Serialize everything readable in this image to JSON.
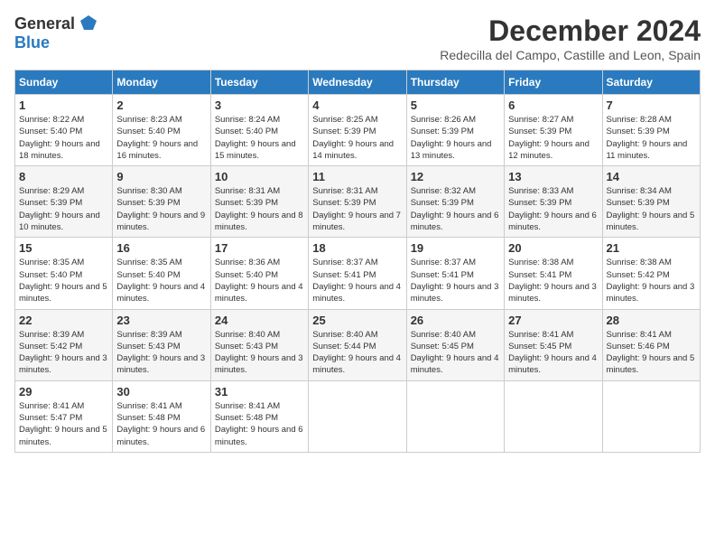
{
  "logo": {
    "general": "General",
    "blue": "Blue"
  },
  "title": {
    "month": "December 2024",
    "location": "Redecilla del Campo, Castille and Leon, Spain"
  },
  "headers": [
    "Sunday",
    "Monday",
    "Tuesday",
    "Wednesday",
    "Thursday",
    "Friday",
    "Saturday"
  ],
  "weeks": [
    [
      {
        "day": "1",
        "sunrise": "8:22 AM",
        "sunset": "5:40 PM",
        "daylight": "9 hours and 18 minutes."
      },
      {
        "day": "2",
        "sunrise": "8:23 AM",
        "sunset": "5:40 PM",
        "daylight": "9 hours and 16 minutes."
      },
      {
        "day": "3",
        "sunrise": "8:24 AM",
        "sunset": "5:40 PM",
        "daylight": "9 hours and 15 minutes."
      },
      {
        "day": "4",
        "sunrise": "8:25 AM",
        "sunset": "5:39 PM",
        "daylight": "9 hours and 14 minutes."
      },
      {
        "day": "5",
        "sunrise": "8:26 AM",
        "sunset": "5:39 PM",
        "daylight": "9 hours and 13 minutes."
      },
      {
        "day": "6",
        "sunrise": "8:27 AM",
        "sunset": "5:39 PM",
        "daylight": "9 hours and 12 minutes."
      },
      {
        "day": "7",
        "sunrise": "8:28 AM",
        "sunset": "5:39 PM",
        "daylight": "9 hours and 11 minutes."
      }
    ],
    [
      {
        "day": "8",
        "sunrise": "8:29 AM",
        "sunset": "5:39 PM",
        "daylight": "9 hours and 10 minutes."
      },
      {
        "day": "9",
        "sunrise": "8:30 AM",
        "sunset": "5:39 PM",
        "daylight": "9 hours and 9 minutes."
      },
      {
        "day": "10",
        "sunrise": "8:31 AM",
        "sunset": "5:39 PM",
        "daylight": "9 hours and 8 minutes."
      },
      {
        "day": "11",
        "sunrise": "8:31 AM",
        "sunset": "5:39 PM",
        "daylight": "9 hours and 7 minutes."
      },
      {
        "day": "12",
        "sunrise": "8:32 AM",
        "sunset": "5:39 PM",
        "daylight": "9 hours and 6 minutes."
      },
      {
        "day": "13",
        "sunrise": "8:33 AM",
        "sunset": "5:39 PM",
        "daylight": "9 hours and 6 minutes."
      },
      {
        "day": "14",
        "sunrise": "8:34 AM",
        "sunset": "5:39 PM",
        "daylight": "9 hours and 5 minutes."
      }
    ],
    [
      {
        "day": "15",
        "sunrise": "8:35 AM",
        "sunset": "5:40 PM",
        "daylight": "9 hours and 5 minutes."
      },
      {
        "day": "16",
        "sunrise": "8:35 AM",
        "sunset": "5:40 PM",
        "daylight": "9 hours and 4 minutes."
      },
      {
        "day": "17",
        "sunrise": "8:36 AM",
        "sunset": "5:40 PM",
        "daylight": "9 hours and 4 minutes."
      },
      {
        "day": "18",
        "sunrise": "8:37 AM",
        "sunset": "5:41 PM",
        "daylight": "9 hours and 4 minutes."
      },
      {
        "day": "19",
        "sunrise": "8:37 AM",
        "sunset": "5:41 PM",
        "daylight": "9 hours and 3 minutes."
      },
      {
        "day": "20",
        "sunrise": "8:38 AM",
        "sunset": "5:41 PM",
        "daylight": "9 hours and 3 minutes."
      },
      {
        "day": "21",
        "sunrise": "8:38 AM",
        "sunset": "5:42 PM",
        "daylight": "9 hours and 3 minutes."
      }
    ],
    [
      {
        "day": "22",
        "sunrise": "8:39 AM",
        "sunset": "5:42 PM",
        "daylight": "9 hours and 3 minutes."
      },
      {
        "day": "23",
        "sunrise": "8:39 AM",
        "sunset": "5:43 PM",
        "daylight": "9 hours and 3 minutes."
      },
      {
        "day": "24",
        "sunrise": "8:40 AM",
        "sunset": "5:43 PM",
        "daylight": "9 hours and 3 minutes."
      },
      {
        "day": "25",
        "sunrise": "8:40 AM",
        "sunset": "5:44 PM",
        "daylight": "9 hours and 4 minutes."
      },
      {
        "day": "26",
        "sunrise": "8:40 AM",
        "sunset": "5:45 PM",
        "daylight": "9 hours and 4 minutes."
      },
      {
        "day": "27",
        "sunrise": "8:41 AM",
        "sunset": "5:45 PM",
        "daylight": "9 hours and 4 minutes."
      },
      {
        "day": "28",
        "sunrise": "8:41 AM",
        "sunset": "5:46 PM",
        "daylight": "9 hours and 5 minutes."
      }
    ],
    [
      {
        "day": "29",
        "sunrise": "8:41 AM",
        "sunset": "5:47 PM",
        "daylight": "9 hours and 5 minutes."
      },
      {
        "day": "30",
        "sunrise": "8:41 AM",
        "sunset": "5:48 PM",
        "daylight": "9 hours and 6 minutes."
      },
      {
        "day": "31",
        "sunrise": "8:41 AM",
        "sunset": "5:48 PM",
        "daylight": "9 hours and 6 minutes."
      },
      null,
      null,
      null,
      null
    ]
  ],
  "labels": {
    "sunrise": "Sunrise:",
    "sunset": "Sunset:",
    "daylight": "Daylight:"
  }
}
